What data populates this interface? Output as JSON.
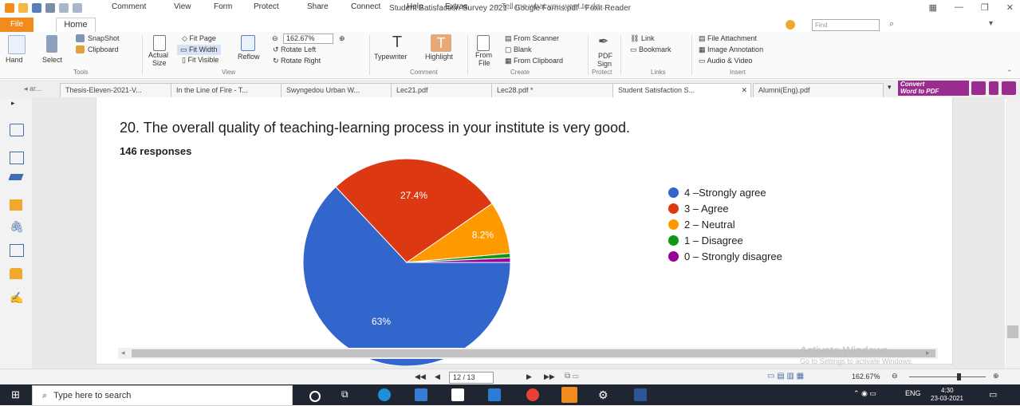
{
  "window": {
    "title": "Student Satisfaction Survey 2021 - Google Forms.pdf - Foxit Reader",
    "find_placeholder": "Find"
  },
  "menu": {
    "file": "File",
    "home": "Home",
    "items": [
      "Comment",
      "View",
      "Form",
      "Protect",
      "Share",
      "Connect",
      "Help",
      "Extras"
    ],
    "tell_me": "Tell me what you want to do..."
  },
  "ribbon": {
    "hand": "Hand",
    "select": "Select",
    "snapshot": "SnapShot",
    "clipboard": "Clipboard",
    "actual_size_1": "Actual",
    "actual_size_2": "Size",
    "fit_page": "Fit Page",
    "fit_width": "Fit Width",
    "fit_visible": "Fit Visible",
    "reflow": "Reflow",
    "zoom_value": "162.67%",
    "rotate_left": "Rotate Left",
    "rotate_right": "Rotate Right",
    "typewriter": "Typewriter",
    "highlight": "Highlight",
    "from_file_1": "From",
    "from_file_2": "File",
    "from_scanner": "From Scanner",
    "blank": "Blank",
    "from_clipboard": "From Clipboard",
    "pdf_sign_1": "PDF",
    "pdf_sign_2": "Sign",
    "link": "Link",
    "bookmark": "Bookmark",
    "file_attachment": "File Attachment",
    "image_annotation": "Image Annotation",
    "audio_video": "Audio & Video",
    "groups": {
      "tools": "Tools",
      "view": "View",
      "comment": "Comment",
      "create": "Create",
      "protect": "Protect",
      "links": "Links",
      "insert": "Insert"
    }
  },
  "doc_tabs": [
    "Thesis-Eleven-2021-V...",
    "In the Line of Fire - T...",
    "Swyngedou Urban W...",
    "Lec21.pdf",
    "Lec28.pdf *",
    "Student Satisfaction S...",
    "Alumni(Eng).pdf"
  ],
  "convert_btn": {
    "line1": "Convert",
    "line2": "Word to PDF"
  },
  "question": {
    "title": "20. The overall quality of teaching-learning process in your institute is very good.",
    "responses": "146 responses"
  },
  "chart_data": {
    "type": "pie",
    "categories": [
      "4 –Strongly agree",
      "3 – Agree",
      "2 – Neutral",
      "1 – Disagree",
      "0 – Strongly disagree"
    ],
    "values": [
      63,
      27.4,
      8.2,
      0.7,
      0.7
    ],
    "labels": [
      "63%",
      "27.4%",
      "8.2%",
      "",
      ""
    ],
    "colors": [
      "#3366cc",
      "#dc3912",
      "#ff9900",
      "#109618",
      "#990099"
    ],
    "legend_position": "right"
  },
  "watermark": {
    "line1": "Activate Windows",
    "line2": "Go to Settings to activate Windows."
  },
  "status": {
    "page": "12 / 13",
    "zoom": "162.67%"
  },
  "taskbar": {
    "search_placeholder": "Type here to search",
    "lang": "ENG",
    "time": "4:30",
    "date": "23-03-2021"
  }
}
